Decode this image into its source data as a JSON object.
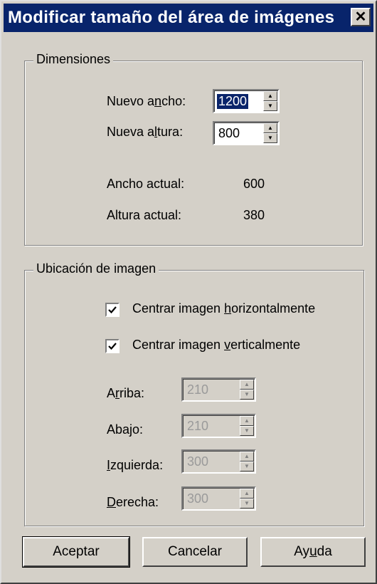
{
  "window": {
    "title": "Modificar tamaño del área de imágenes",
    "close_glyph": "✕"
  },
  "dimensions": {
    "legend": "Dimensiones",
    "new_width": {
      "label_pre": "Nuevo a",
      "label_accel": "n",
      "label_post": "cho:",
      "value": "1200"
    },
    "new_height": {
      "label_pre": "Nueva a",
      "label_accel": "l",
      "label_post": "tura:",
      "value": "800"
    },
    "current_width": {
      "label": "Ancho actual:",
      "value": "600"
    },
    "current_height": {
      "label": "Altura actual:",
      "value": "380"
    }
  },
  "placement": {
    "legend": "Ubicación de imagen",
    "center_h": {
      "label_pre": "Centrar imagen ",
      "label_accel": "h",
      "label_post": "orizontalmente",
      "checked": true
    },
    "center_v": {
      "label_pre": "Centrar imagen ",
      "label_accel": "v",
      "label_post": "erticalmente",
      "checked": true
    },
    "top": {
      "label_pre": "A",
      "label_accel": "r",
      "label_post": "riba:",
      "value": "210"
    },
    "bottom": {
      "label_pre": "Abajo:",
      "label_accel": "",
      "label_post": "",
      "value": "210"
    },
    "left": {
      "label_pre": "",
      "label_accel": "I",
      "label_post": "zquierda:",
      "value": "300"
    },
    "right": {
      "label_pre": "",
      "label_accel": "D",
      "label_post": "erecha:",
      "value": "300"
    }
  },
  "buttons": {
    "accept": "Aceptar",
    "cancel": "Cancelar",
    "help": {
      "pre": "Ay",
      "accel": "u",
      "post": "da"
    }
  },
  "icons": {
    "spin_up": "up-arrow-icon",
    "spin_down": "down-arrow-icon",
    "check": "checkmark-icon",
    "close": "close-icon"
  }
}
